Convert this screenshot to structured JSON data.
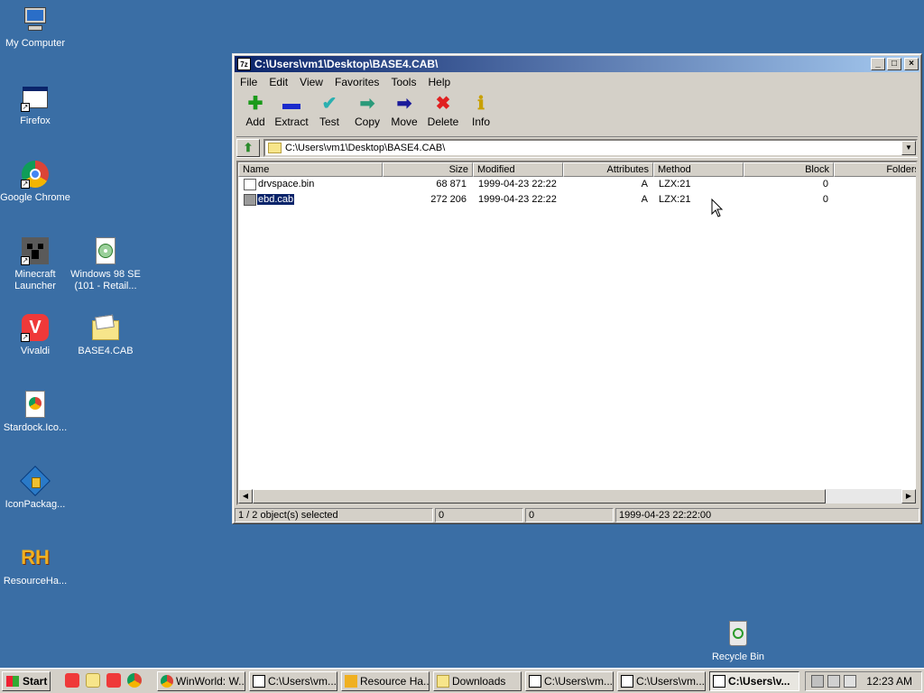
{
  "desktop": {
    "icons": [
      {
        "label": "My Computer"
      },
      {
        "label": "Firefox"
      },
      {
        "label": "Google Chrome"
      },
      {
        "label": "Minecraft Launcher"
      },
      {
        "label": "Windows 98 SE (101 - Retail..."
      },
      {
        "label": "Vivaldi"
      },
      {
        "label": "BASE4.CAB"
      },
      {
        "label": "Stardock.Ico..."
      },
      {
        "label": "IconPackag..."
      },
      {
        "label": "ResourceHa..."
      },
      {
        "label": "Recycle Bin"
      }
    ]
  },
  "window": {
    "title": "C:\\Users\\vm1\\Desktop\\BASE4.CAB\\",
    "app_icon_text": "7z",
    "menu": [
      "File",
      "Edit",
      "View",
      "Favorites",
      "Tools",
      "Help"
    ],
    "toolbar": [
      {
        "label": "Add",
        "icon": "plus-icon",
        "color": "#1a9a1a"
      },
      {
        "label": "Extract",
        "icon": "minus-icon",
        "color": "#1a2acc"
      },
      {
        "label": "Test",
        "icon": "check-icon",
        "color": "#2ab0b0"
      },
      {
        "label": "Copy",
        "icon": "copy-arrow-icon",
        "color": "#2a9a7a"
      },
      {
        "label": "Move",
        "icon": "move-arrow-icon",
        "color": "#1a1a9a"
      },
      {
        "label": "Delete",
        "icon": "delete-x-icon",
        "color": "#e02020"
      },
      {
        "label": "Info",
        "icon": "info-icon",
        "color": "#c8a000"
      }
    ],
    "address": "C:\\Users\\vm1\\Desktop\\BASE4.CAB\\",
    "columns": [
      "Name",
      "Size",
      "Modified",
      "Attributes",
      "Method",
      "Block",
      "Folders"
    ],
    "rows": [
      {
        "name": "drvspace.bin",
        "size": "68 871",
        "modified": "1999-04-23 22:22",
        "attributes": "A",
        "method": "LZX:21",
        "block": "0",
        "folders": "",
        "selected": false
      },
      {
        "name": "ebd.cab",
        "size": "272 206",
        "modified": "1999-04-23 22:22",
        "attributes": "A",
        "method": "LZX:21",
        "block": "0",
        "folders": "",
        "selected": true
      }
    ],
    "status": [
      "1 / 2 object(s) selected",
      "0",
      "0",
      "1999-04-23 22:22:00"
    ]
  },
  "taskbar": {
    "start_label": "Start",
    "tasks": [
      {
        "label": "WinWorld: W...",
        "active": false
      },
      {
        "label": "C:\\Users\\vm...",
        "active": false
      },
      {
        "label": "Resource Ha...",
        "active": false
      },
      {
        "label": "Downloads",
        "active": false
      },
      {
        "label": "C:\\Users\\vm...",
        "active": false
      },
      {
        "label": "C:\\Users\\vm...",
        "active": false
      },
      {
        "label": "C:\\Users\\v...",
        "active": true
      }
    ],
    "clock": "12:23 AM"
  }
}
